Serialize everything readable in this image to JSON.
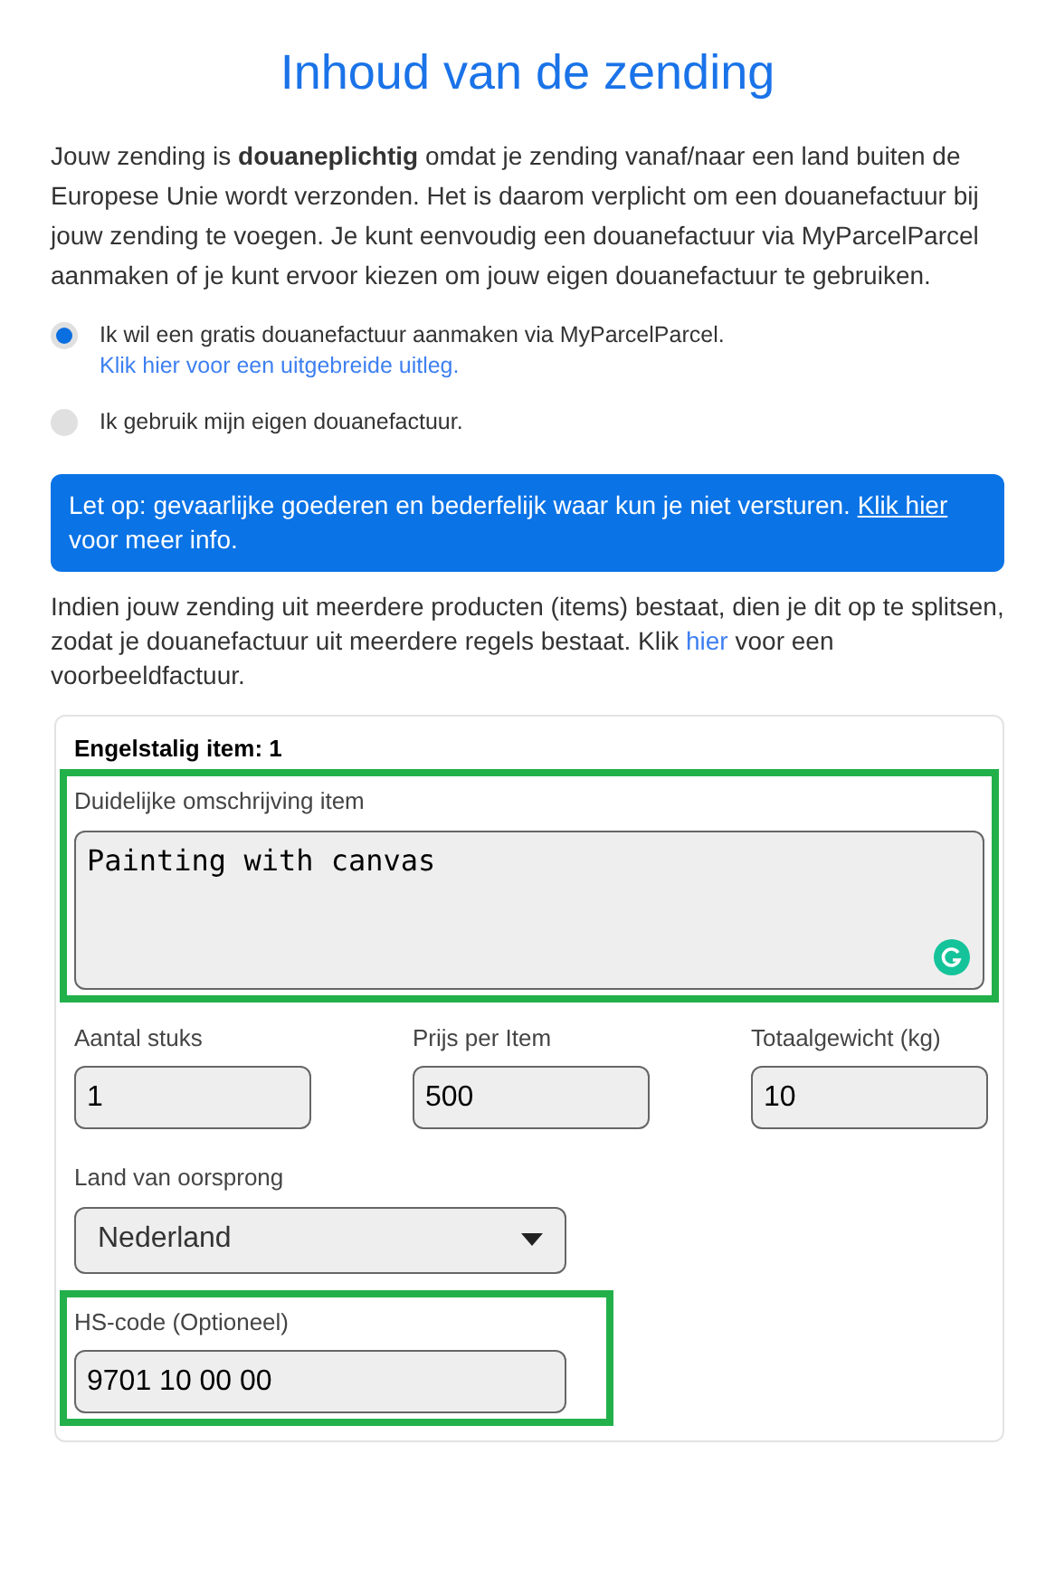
{
  "title": "Inhoud van de zending",
  "intro": "Jouw zending is **douaneplichtig** omdat je zending vanaf/naar een land buiten de Europese Unie wordt verzonden. Het is daarom verplicht om een douanefactuur bij jouw zending te voegen. Je kunt eenvoudig een douanefactuur via MyParcelParcel aanmaken of je kunt ervoor kiezen om jouw eigen douanefactuur te gebruiken.",
  "options": [
    {
      "label": "Ik wil een gratis douanefactuur aanmaken via MyParcelParcel.",
      "link": "Klik hier voor een uitgebreide uitleg.",
      "selected": true
    },
    {
      "label": "Ik gebruik mijn eigen douanefactuur.",
      "selected": false
    }
  ],
  "alert": {
    "text": "Let op: gevaarlijke goederen en bederfelijk waar kun je niet versturen.",
    "link": "Klik hier",
    "after": "voor meer info."
  },
  "note": {
    "text": "Indien jouw zending uit meerdere producten (items) bestaat, dien je dit op te splitsen, zodat je douanefactuur uit meerdere regels bestaat. Klik",
    "link": "hier",
    "after": "voor een voorbeeldfactuur."
  },
  "item": {
    "heading": "Engelstalig item: 1",
    "fields": [
      {
        "kind": "textarea",
        "label": "Duidelijke omschrijving item",
        "value": "Painting with canvas",
        "highlighted": true
      },
      {
        "kind": "input",
        "label": "Aantal stuks",
        "value": "1",
        "highlighted": false
      },
      {
        "kind": "input",
        "label": "Prijs per Item",
        "value": "500",
        "highlighted": false
      },
      {
        "kind": "input",
        "label": "Totaalgewicht (kg)",
        "value": "10",
        "highlighted": false
      },
      {
        "kind": "select",
        "label": "Land van oorsprong",
        "value": "Nederland",
        "highlighted": false
      },
      {
        "kind": "input",
        "label": "HS-code (Optioneel)",
        "value": "9701 10 00 00",
        "highlighted": true
      }
    ]
  }
}
